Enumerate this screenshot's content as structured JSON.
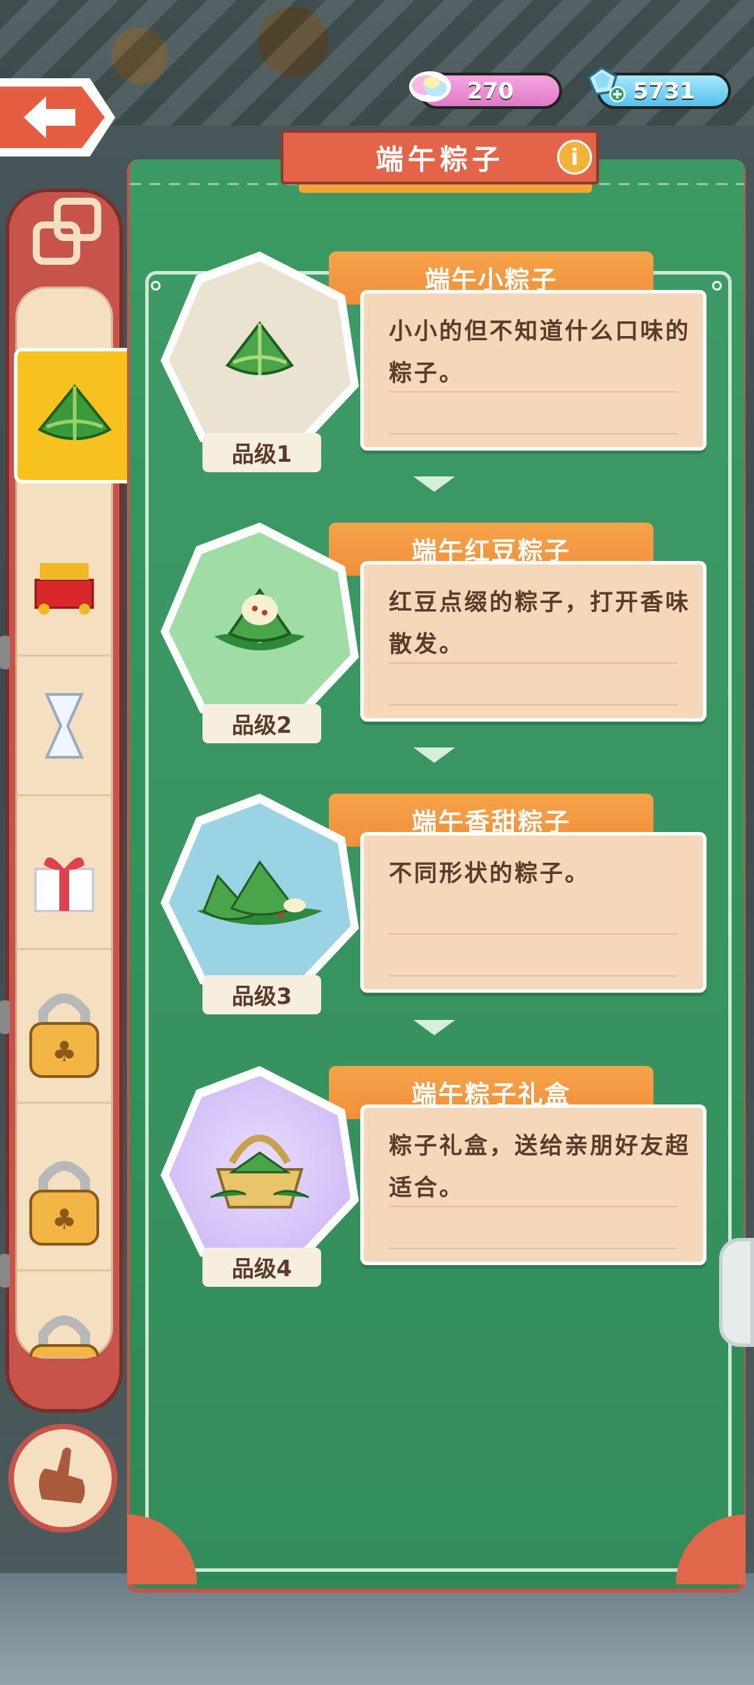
{
  "header": {
    "pink_currency": "270",
    "blue_currency": "5731"
  },
  "panel": {
    "title": "端午粽子",
    "info_icon": "i"
  },
  "items": [
    {
      "name": "端午小粽子",
      "description": "小小的但不知道什么口味的粽子。",
      "grade": "品级1",
      "bg": "#ebe3d2"
    },
    {
      "name": "端午红豆粽子",
      "description": "红豆点缀的粽子，打开香味散发。",
      "grade": "品级2",
      "bg": "#9fdca6"
    },
    {
      "name": "端午香甜粽子",
      "description": "不同形状的粽子。",
      "grade": "品级3",
      "bg": "#9ad3e3"
    },
    {
      "name": "端午粽子礼盒",
      "description": "粽子礼盒，送给亲朋好友超适合。",
      "grade": "品级4",
      "bg": "#c9b3f2"
    }
  ],
  "sidebar": {
    "items": [
      "zongzi-icon",
      "dragon-boat-icon",
      "hourglass-icon",
      "gift-icon",
      "lock-icon",
      "lock-icon",
      "lock-icon"
    ]
  },
  "colors": {
    "accent": "#e4644a",
    "panel": "#2f8a55",
    "card": "#f5d8ba"
  }
}
